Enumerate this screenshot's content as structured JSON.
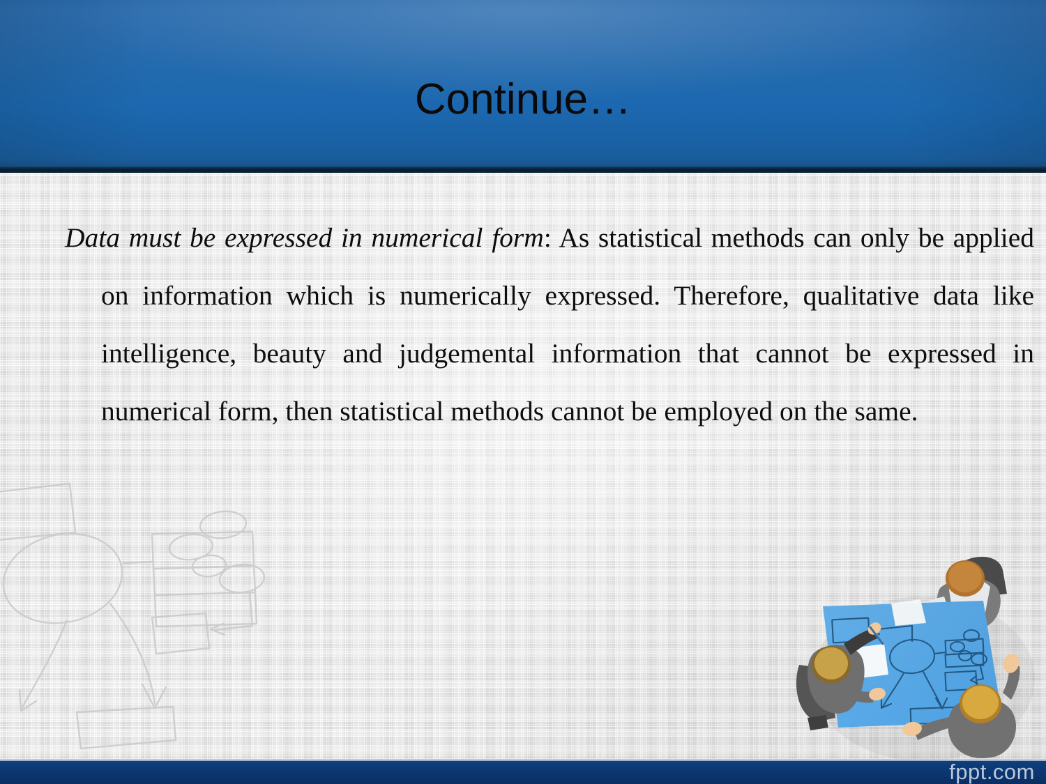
{
  "slide": {
    "title": "Continue…",
    "body": {
      "lead_italic": "Data must be expressed in numerical form",
      "rest": ": As statistical methods can only be applied on information which is numerically expressed. Therefore, qualitative data like intelligence, beauty and judgemental information that cannot be expressed in numerical form, then statistical methods cannot be employed on the same.",
      "full_text": "Data must be expressed in numerical form: As statistical methods can only be applied on information which is numerically expressed. Therefore, qualitative data like intelligence, beauty and judgemental information that cannot be expressed in numerical form, then statistical methods cannot be employed on the same."
    }
  },
  "footer": {
    "brand": "fppt.com"
  },
  "graphics": {
    "watermark_diagram": "flowchart-watermark",
    "meeting_illustration": "team-meeting-around-table-illustration"
  },
  "colors": {
    "header_blue_top": "#2a6aab",
    "header_blue_bottom": "#17548d",
    "header_edge_dark": "#081a29",
    "body_canvas": "#e9e9e9",
    "footer_navy": "#0c3570",
    "footer_brand_text": "#b9c8dc",
    "title_text": "#0a0a0a",
    "body_text": "#0d0d0d",
    "illustration_table_blue": "#5aabe8",
    "watermark_stroke": "#cfcfcf"
  }
}
